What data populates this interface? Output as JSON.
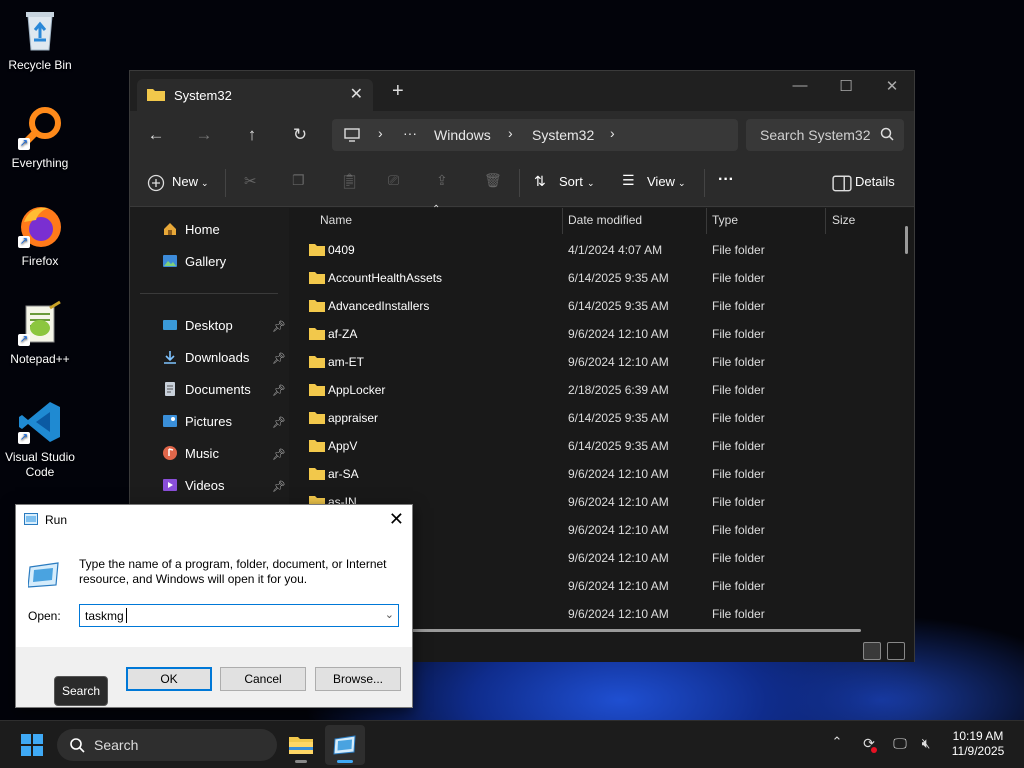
{
  "desktop": {
    "icons": [
      {
        "label": "Recycle Bin"
      },
      {
        "label": "Everything"
      },
      {
        "label": "Firefox"
      },
      {
        "label": "Notepad++"
      },
      {
        "label": "Visual Studio Code"
      }
    ]
  },
  "explorer": {
    "tab_title": "System32",
    "address": {
      "segments": [
        "Windows",
        "System32"
      ],
      "ellipsis": "···"
    },
    "search_placeholder": "Search System32",
    "commands": {
      "new": "New",
      "sort": "Sort",
      "view": "View",
      "more": "···",
      "details": "Details"
    },
    "sidebar": {
      "top": [
        {
          "label": "Home"
        },
        {
          "label": "Gallery"
        }
      ],
      "pinned": [
        {
          "label": "Desktop"
        },
        {
          "label": "Downloads"
        },
        {
          "label": "Documents"
        },
        {
          "label": "Pictures"
        },
        {
          "label": "Music"
        },
        {
          "label": "Videos"
        }
      ]
    },
    "columns": {
      "name": "Name",
      "date": "Date modified",
      "type": "Type",
      "size": "Size"
    },
    "rows": [
      {
        "name": "0409",
        "date": "4/1/2024 4:07 AM",
        "type": "File folder"
      },
      {
        "name": "AccountHealthAssets",
        "date": "6/14/2025 9:35 AM",
        "type": "File folder"
      },
      {
        "name": "AdvancedInstallers",
        "date": "6/14/2025 9:35 AM",
        "type": "File folder"
      },
      {
        "name": "af-ZA",
        "date": "9/6/2024 12:10 AM",
        "type": "File folder"
      },
      {
        "name": "am-ET",
        "date": "9/6/2024 12:10 AM",
        "type": "File folder"
      },
      {
        "name": "AppLocker",
        "date": "2/18/2025 6:39 AM",
        "type": "File folder"
      },
      {
        "name": "appraiser",
        "date": "6/14/2025 9:35 AM",
        "type": "File folder"
      },
      {
        "name": "AppV",
        "date": "6/14/2025 9:35 AM",
        "type": "File folder"
      },
      {
        "name": "ar-SA",
        "date": "9/6/2024 12:10 AM",
        "type": "File folder"
      },
      {
        "name": "as-IN",
        "date": "9/6/2024 12:10 AM",
        "type": "File folder"
      },
      {
        "name": "",
        "date": "9/6/2024 12:10 AM",
        "type": "File folder"
      },
      {
        "name": "",
        "date": "9/6/2024 12:10 AM",
        "type": "File folder"
      },
      {
        "name": "",
        "date": "9/6/2024 12:10 AM",
        "type": "File folder"
      },
      {
        "name": "",
        "date": "9/6/2024 12:10 AM",
        "type": "File folder"
      }
    ]
  },
  "run_dialog": {
    "title": "Run",
    "description": "Type the name of a program, folder, document, or Internet resource, and Windows will open it for you.",
    "open_label": "Open:",
    "open_value": "taskmg",
    "ok": "OK",
    "cancel": "Cancel",
    "browse": "Browse..."
  },
  "tooltip": "Search",
  "taskbar": {
    "search_placeholder": "Search",
    "time": "10:19 AM",
    "date": "11/9/2025"
  },
  "colors": {
    "folder": "#f2c84b",
    "accent": "#0078d7",
    "vscode": "#1f8ad2",
    "firefox": "#ff7a1a"
  }
}
